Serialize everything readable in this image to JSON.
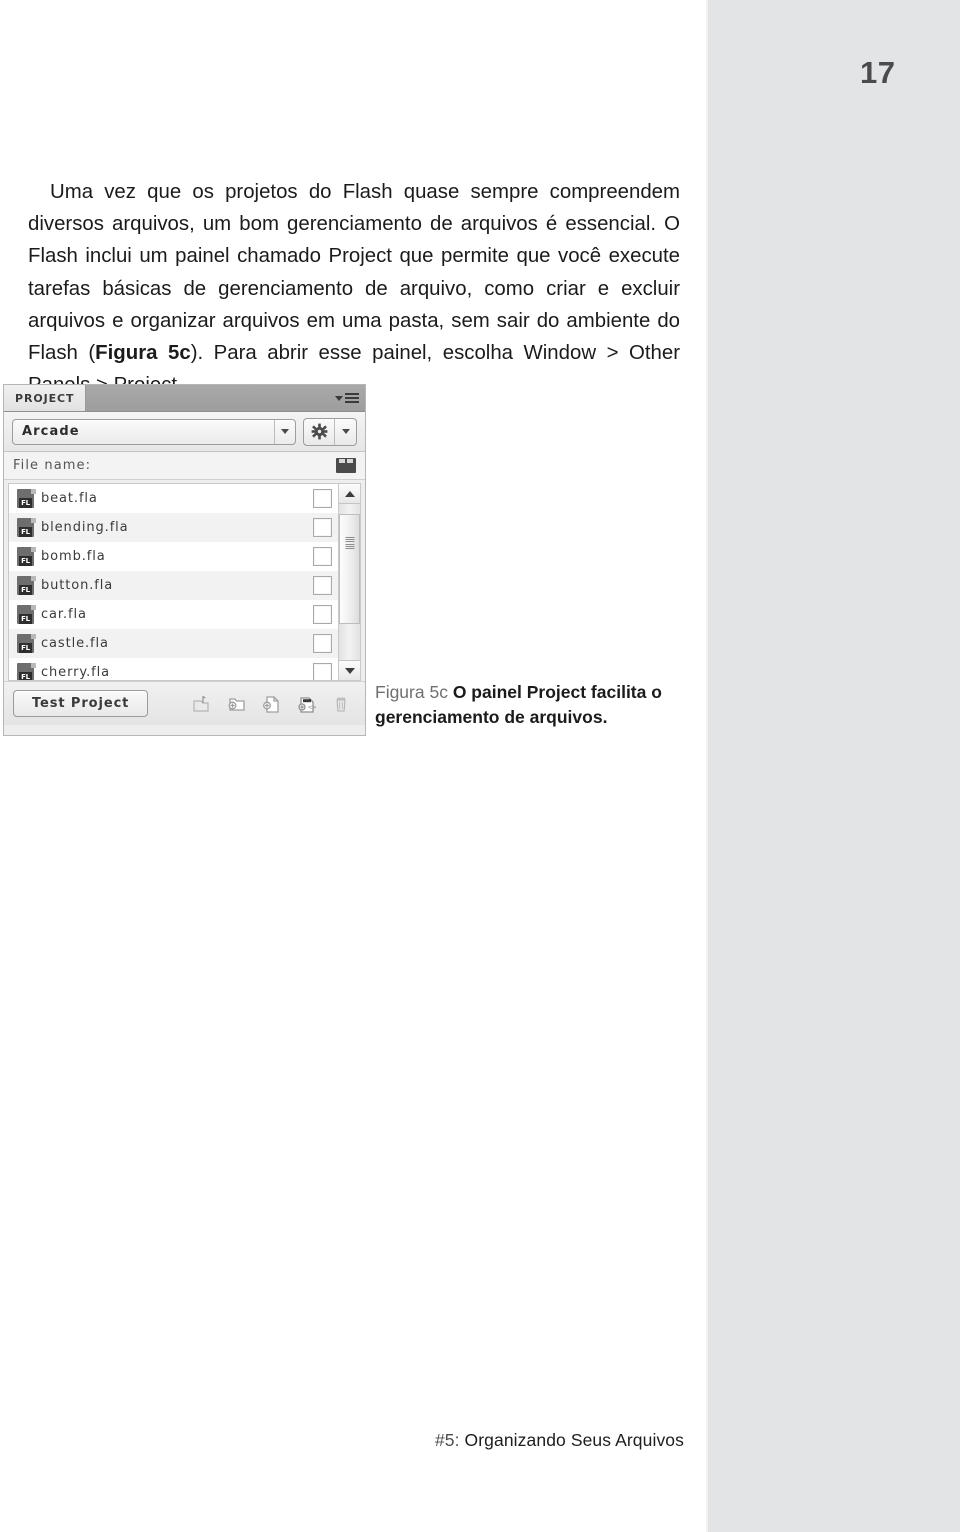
{
  "page": {
    "folio": "17",
    "footer_prefix": "#5:",
    "footer_text": "Organizando Seus Arquivos",
    "band_color": "#e3e4e6"
  },
  "body": {
    "paragraph": "Uma vez que os projetos do Flash quase sempre compreendem diversos arquivos, um bom gerenciamento de arquivos é essencial. O Flash inclui um painel chamado Project que permite que você execute tarefas básicas de gerenciamento de arquivo, como criar e excluir arquivos e organizar arquivos em uma pasta, sem sair do ambiente do Flash (",
    "paragraph_bold": "Figura 5c",
    "paragraph_tail": "). Para abrir esse painel, escolha Window > Other Panels > Project."
  },
  "figure": {
    "caption_label": "Figura 5c",
    "caption_text": "O painel Project facilita o gerenciamento de arquivos."
  },
  "panel": {
    "tab_title": "PROJECT",
    "menu_icon": "panel-menu-icon",
    "project_name": "Arcade",
    "gear_icon": "gear-icon",
    "filename_header": "File name:",
    "folder_icon": "folder-icon",
    "file_icon_badge": "FL",
    "files": [
      {
        "name": "beat.fla"
      },
      {
        "name": "blending.fla"
      },
      {
        "name": "bomb.fla"
      },
      {
        "name": "button.fla"
      },
      {
        "name": "car.fla"
      },
      {
        "name": "castle.fla"
      },
      {
        "name": "cherry.fla"
      }
    ],
    "test_button": "Test Project",
    "tools": [
      {
        "name": "add-to-project-icon"
      },
      {
        "name": "new-folder-icon"
      },
      {
        "name": "new-file-icon"
      },
      {
        "name": "new-class-file-icon"
      },
      {
        "name": "delete-icon"
      }
    ]
  }
}
